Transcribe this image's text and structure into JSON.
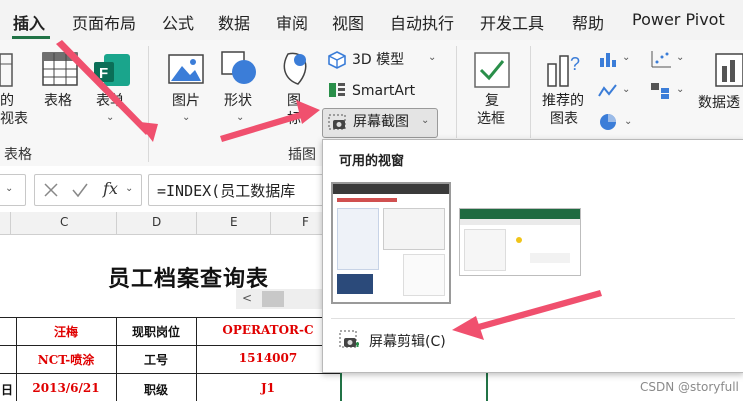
{
  "tabs": [
    {
      "label": "插入",
      "active": true
    },
    {
      "label": "页面布局"
    },
    {
      "label": "公式"
    },
    {
      "label": "数据"
    },
    {
      "label": "审阅"
    },
    {
      "label": "视图"
    },
    {
      "label": "自动执行"
    },
    {
      "label": "开发工具"
    },
    {
      "label": "帮助"
    },
    {
      "label": "Power Pivot"
    }
  ],
  "ribbon": {
    "partial_left": [
      "的",
      "视表"
    ],
    "tables_group": {
      "table_label": "表格",
      "form_label": "表单",
      "group_label": "表格"
    },
    "illustrations": {
      "picture_label": "图片",
      "shapes_label": "形状",
      "icons_label_1": "图",
      "icons_label_2": "标",
      "model3d_label": "3D 模型",
      "smartart_label": "SmartArt",
      "screenshot_label": "屏幕截图",
      "group_label": "插图"
    },
    "checkbox": {
      "label_1": "复",
      "label_2": "选框"
    },
    "charts": {
      "recommended_1": "推荐的",
      "recommended_2": "图表",
      "pivot_partial": "数据透"
    }
  },
  "formula_bar": {
    "fx": "fx",
    "formula": "=INDEX(员工数据库"
  },
  "columns": [
    "C",
    "D",
    "E",
    "F"
  ],
  "sheet": {
    "title": "员工档案查询表",
    "rows": [
      [
        "汪梅",
        "现职岗位",
        "OPERATOR-C"
      ],
      [
        "NCT-喷涂",
        "工号",
        "1514007"
      ],
      [
        "2013/6/21",
        "职级",
        "J1"
      ]
    ],
    "left_partial": "日"
  },
  "dropdown": {
    "header": "可用的视窗",
    "clip_label": "屏幕剪辑(C)"
  },
  "watermark": "CSDN @storyfull",
  "colors": {
    "accent": "#217346",
    "arrow": "#f0506e",
    "red_text": "#e00000"
  }
}
